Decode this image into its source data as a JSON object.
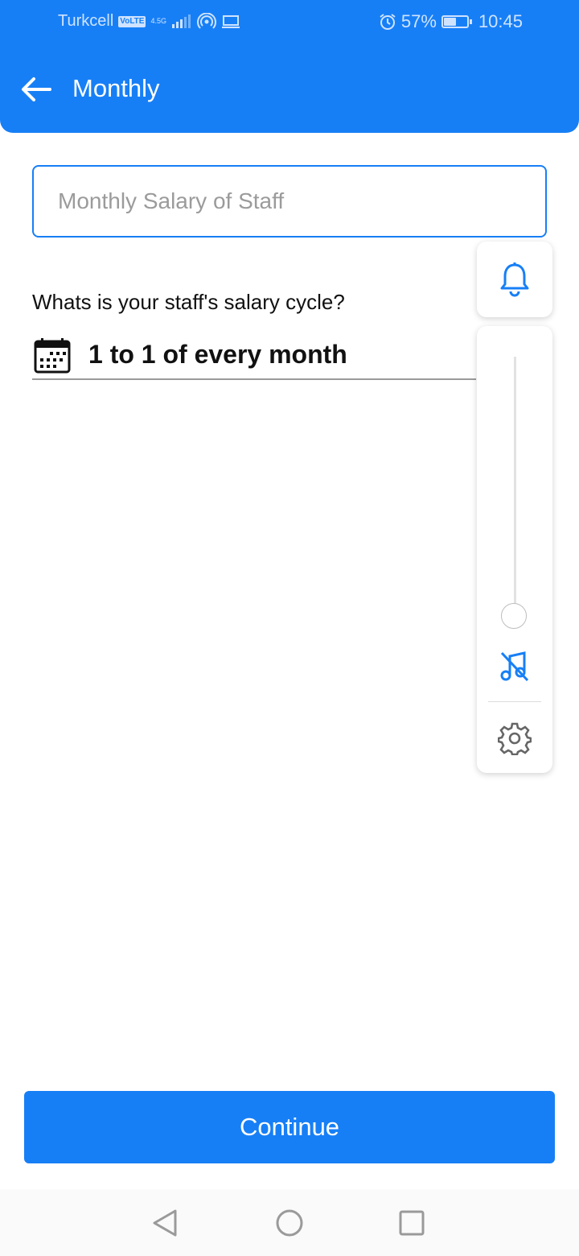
{
  "status_bar": {
    "carrier": "Turkcell",
    "volte": "VoLTE",
    "network": "4.5G",
    "battery": "57%",
    "battery_level": 0.57,
    "time": "10:45"
  },
  "header": {
    "back_icon": "arrow-left-icon",
    "title": "Monthly"
  },
  "form": {
    "salary_input": {
      "value": "",
      "placeholder": "Monthly Salary of Staff"
    },
    "cycle_question": "Whats is your staff's salary cycle?",
    "cycle_icon": "calendar-icon",
    "cycle_value": "1 to 1 of every month"
  },
  "volume_panel": {
    "icons": [
      "bell-icon",
      "music-off-icon",
      "gear-icon"
    ],
    "level": 0
  },
  "footer": {
    "continue_label": "Continue"
  },
  "nav_bar": {
    "icons": [
      "back-triangle-icon",
      "home-circle-icon",
      "recents-square-icon"
    ]
  },
  "colors": {
    "primary": "#177ff6",
    "background": "#ffffff"
  }
}
